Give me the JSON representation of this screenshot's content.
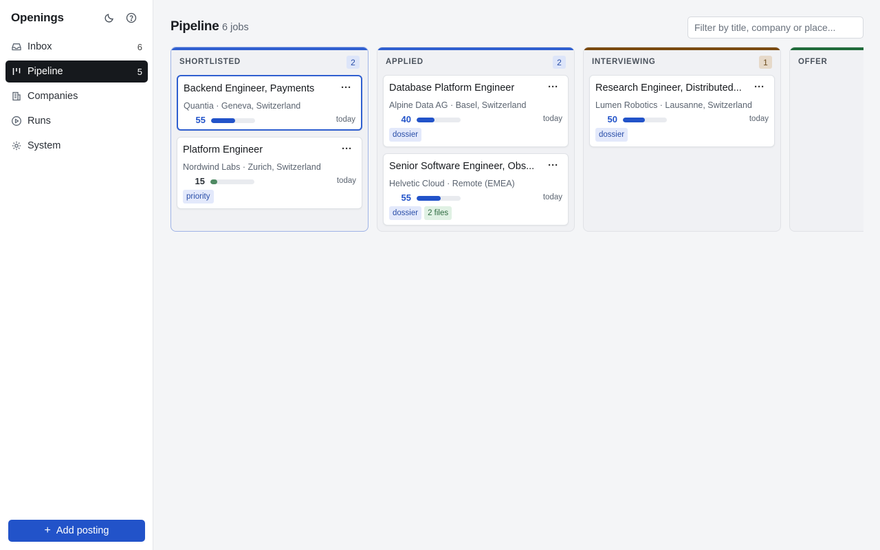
{
  "sidebar": {
    "brand": "Openings",
    "items": [
      {
        "label": "Inbox",
        "count": "6",
        "icon": "inbox-icon"
      },
      {
        "label": "Pipeline",
        "count": "5",
        "icon": "kanban-icon",
        "active": true
      },
      {
        "label": "Companies",
        "count": "",
        "icon": "building-icon"
      },
      {
        "label": "Runs",
        "count": "",
        "icon": "play-circle-icon"
      },
      {
        "label": "System",
        "count": "",
        "icon": "gear-icon"
      }
    ],
    "add_label": "Add posting"
  },
  "header": {
    "title": "Pipeline",
    "subtitle": "6 jobs",
    "filter_placeholder": "Filter by title, company or place..."
  },
  "colors": {
    "accent": "#2253c9",
    "shortlisted": "#2f5fd0",
    "applied": "#2f5fd0",
    "interviewing": "#7a4a10",
    "offer": "#1f6b3a",
    "score_blue": "#2253c9",
    "score_green": "#4f8a63"
  },
  "columns": [
    {
      "title": "SHORTLISTED",
      "count": "2",
      "cards": [
        {
          "title": "Backend Engineer, Payments",
          "meta": "Quantia · Geneva, Switzerland",
          "score": "55",
          "progress": 0.55,
          "date": "today",
          "tags": []
        },
        {
          "title": "Platform Engineer",
          "meta": "Nordwind Labs · Zurich, Switzerland",
          "score": "15",
          "progress": 0.15,
          "date": "today",
          "tags": [
            "priority"
          ]
        }
      ]
    },
    {
      "title": "APPLIED",
      "count": "2",
      "cards": [
        {
          "title": "Database Platform Engineer",
          "meta": "Alpine Data AG · Basel, Switzerland",
          "score": "40",
          "progress": 0.4,
          "date": "today",
          "tags": [
            "dossier"
          ]
        },
        {
          "title": "Senior Software Engineer, Obs...",
          "meta": "Helvetic Cloud · Remote (EMEA)",
          "score": "55",
          "progress": 0.55,
          "date": "today",
          "tags": [
            "dossier",
            "2 files"
          ]
        }
      ]
    },
    {
      "title": "INTERVIEWING",
      "count": "1",
      "cards": [
        {
          "title": "Research Engineer, Distributed...",
          "meta": "Lumen Robotics · Lausanne, Switzerland",
          "score": "50",
          "progress": 0.5,
          "date": "today",
          "tags": [
            "dossier"
          ]
        }
      ]
    },
    {
      "title": "OFFER",
      "count": "",
      "cards": []
    }
  ]
}
